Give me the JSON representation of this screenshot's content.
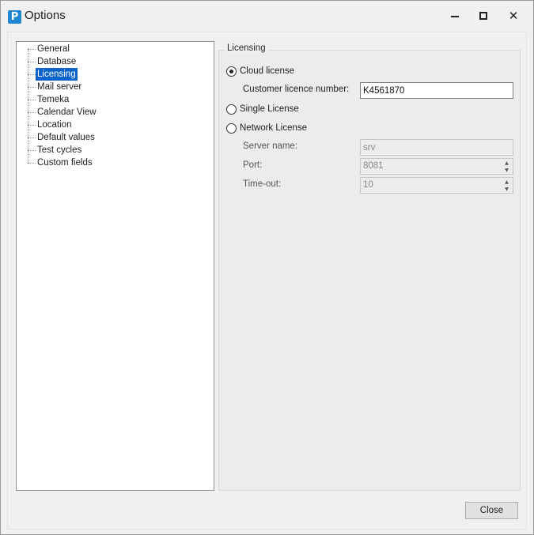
{
  "window": {
    "title": "Options",
    "app_icon_letter": "P",
    "controls": {
      "minimize": "minimize-icon",
      "maximize": "maximize-icon",
      "close_glyph": "✕"
    }
  },
  "tree": {
    "items": [
      {
        "label": "General"
      },
      {
        "label": "Database"
      },
      {
        "label": "Licensing",
        "selected": true
      },
      {
        "label": "Mail server"
      },
      {
        "label": "Temeka"
      },
      {
        "label": "Calendar View"
      },
      {
        "label": "Location"
      },
      {
        "label": "Default values"
      },
      {
        "label": "Test cycles"
      },
      {
        "label": "Custom fields"
      }
    ]
  },
  "licensing": {
    "group_title": "Licensing",
    "cloud_license_label": "Cloud license",
    "customer_licence_label": "Customer licence number:",
    "customer_licence_value": "K4561870",
    "single_license_label": "Single License",
    "network_license_label": "Network License",
    "server_name_label": "Server name:",
    "server_name_value": "srv",
    "port_label": "Port:",
    "port_value": "8081",
    "timeout_label": "Time-out:",
    "timeout_value": "10",
    "selected_option": "Cloud license"
  },
  "footer": {
    "close_label": "Close"
  },
  "colors": {
    "selection": "#0a63c9",
    "app_icon": "#1f86d1"
  }
}
